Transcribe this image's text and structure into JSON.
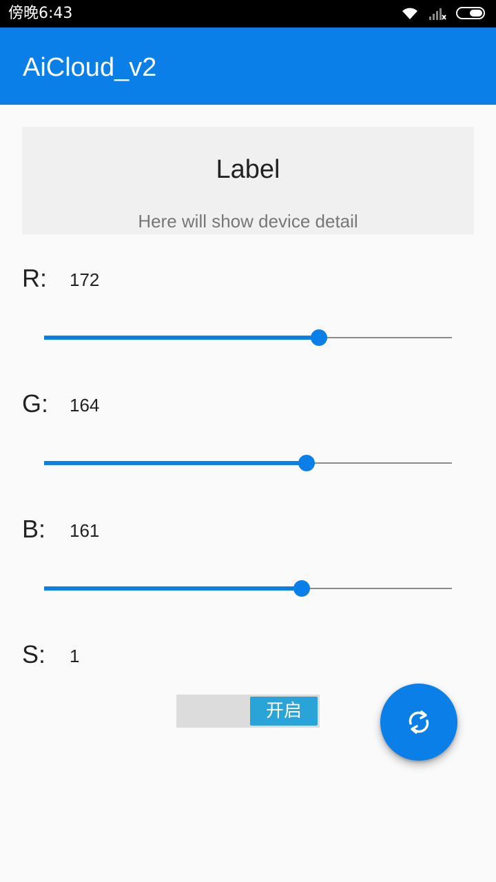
{
  "status": {
    "time": "傍晚6:43",
    "icons": [
      "wifi-icon",
      "signal-icon",
      "battery-icon"
    ]
  },
  "appbar": {
    "title": "AiCloud_v2",
    "color": "#0a7fe8"
  },
  "detail": {
    "label": "Label",
    "subtitle": "Here will show device detail"
  },
  "channels": [
    {
      "letter": "R:",
      "value": "172",
      "level": 172,
      "max": 255
    },
    {
      "letter": "G:",
      "value": "164",
      "level": 164,
      "max": 255
    },
    {
      "letter": "B:",
      "value": "161",
      "level": 161,
      "max": 255
    }
  ],
  "switch_row": {
    "letter": "S:",
    "value": "1"
  },
  "toggle": {
    "label": "开启",
    "state": "on"
  },
  "fab": {
    "icon": "refresh-icon"
  },
  "colors": {
    "accent": "#0a7fe8",
    "toggle_on": "#2aa3d8"
  }
}
